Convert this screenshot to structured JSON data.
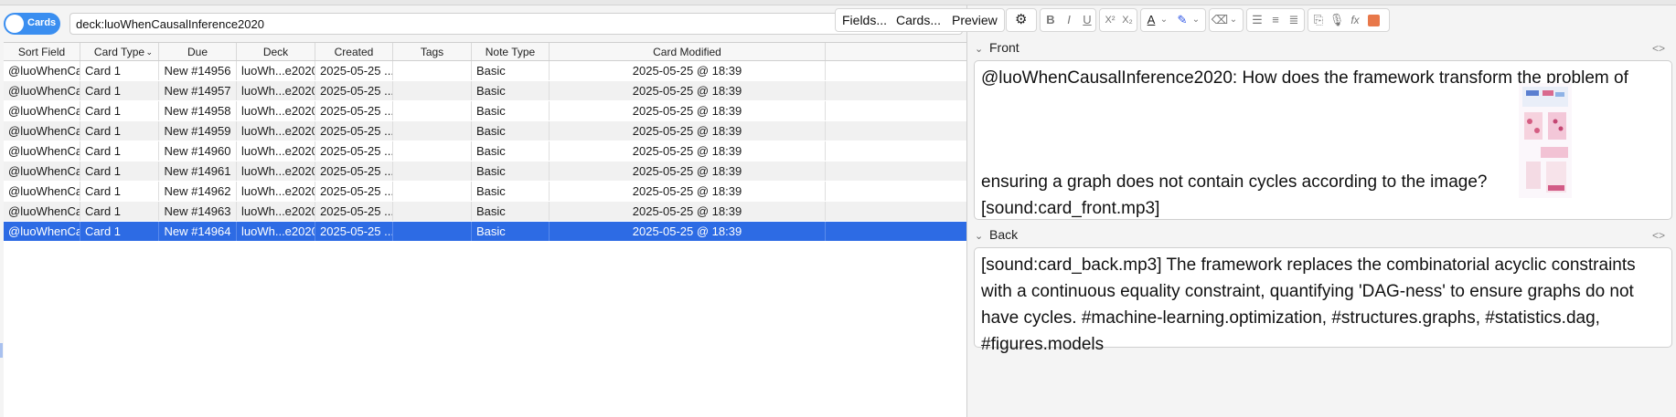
{
  "browser": {
    "mode_toggle_label": "Cards",
    "search_query": "deck:luoWhenCausalInference2020",
    "columns": [
      "Sort Field",
      "Card Type",
      "Due",
      "Deck",
      "Created",
      "Tags",
      "Note Type",
      "Card Modified"
    ],
    "rows": [
      {
        "sort_field": "@luoWhenCa...",
        "card_type": "Card 1",
        "due": "New #14956",
        "deck": "luoWh...e2020",
        "created": "2025-05-25 ...",
        "tags": "",
        "note_type": "Basic",
        "modified": "2025-05-25 @ 18:39"
      },
      {
        "sort_field": "@luoWhenCa...",
        "card_type": "Card 1",
        "due": "New #14957",
        "deck": "luoWh...e2020",
        "created": "2025-05-25 ...",
        "tags": "",
        "note_type": "Basic",
        "modified": "2025-05-25 @ 18:39"
      },
      {
        "sort_field": "@luoWhenCa...",
        "card_type": "Card 1",
        "due": "New #14958",
        "deck": "luoWh...e2020",
        "created": "2025-05-25 ...",
        "tags": "",
        "note_type": "Basic",
        "modified": "2025-05-25 @ 18:39"
      },
      {
        "sort_field": "@luoWhenCa...",
        "card_type": "Card 1",
        "due": "New #14959",
        "deck": "luoWh...e2020",
        "created": "2025-05-25 ...",
        "tags": "",
        "note_type": "Basic",
        "modified": "2025-05-25 @ 18:39"
      },
      {
        "sort_field": "@luoWhenCa...",
        "card_type": "Card 1",
        "due": "New #14960",
        "deck": "luoWh...e2020",
        "created": "2025-05-25 ...",
        "tags": "",
        "note_type": "Basic",
        "modified": "2025-05-25 @ 18:39"
      },
      {
        "sort_field": "@luoWhenCa...",
        "card_type": "Card 1",
        "due": "New #14961",
        "deck": "luoWh...e2020",
        "created": "2025-05-25 ...",
        "tags": "",
        "note_type": "Basic",
        "modified": "2025-05-25 @ 18:39"
      },
      {
        "sort_field": "@luoWhenCa...",
        "card_type": "Card 1",
        "due": "New #14962",
        "deck": "luoWh...e2020",
        "created": "2025-05-25 ...",
        "tags": "",
        "note_type": "Basic",
        "modified": "2025-05-25 @ 18:39"
      },
      {
        "sort_field": "@luoWhenCa...",
        "card_type": "Card 1",
        "due": "New #14963",
        "deck": "luoWh...e2020",
        "created": "2025-05-25 ...",
        "tags": "",
        "note_type": "Basic",
        "modified": "2025-05-25 @ 18:39"
      },
      {
        "sort_field": "@luoWhenCa...",
        "card_type": "Card 1",
        "due": "New #14964",
        "deck": "luoWh...e2020",
        "created": "2025-05-25 ...",
        "tags": "",
        "note_type": "Basic",
        "modified": "2025-05-25 @ 18:39"
      }
    ],
    "selected_row_index": 8
  },
  "editor": {
    "fields_button": "Fields...",
    "cards_button": "Cards...",
    "preview_button": "Preview",
    "format_buttons": {
      "bold": "B",
      "italic": "I",
      "underline": "U",
      "superscript": "X²",
      "subscript": "X₂",
      "text_color": "A",
      "function": "fx"
    },
    "front_label": "Front",
    "front_text_1": "@luoWhenCausalInference2020: How does the framework transform the problem of",
    "front_text_2": "ensuring a graph does not contain cycles according to the image?",
    "front_text_3": "[sound:card_front.mp3]",
    "back_label": "Back",
    "back_text": "[sound:card_back.mp3] The framework replaces the combinatorial acyclic constraints with a continuous equality constraint, quantifying 'DAG-ness' to ensure graphs do not have cycles. #machine-learning.optimization, #structures.graphs, #statistics.dag, #figures.models"
  },
  "colors": {
    "accent": "#2d6be4",
    "toggle": "#3a8ef0",
    "text_color_swatch": "#1a1a1a",
    "highlight_swatch": "#2f56e6"
  }
}
